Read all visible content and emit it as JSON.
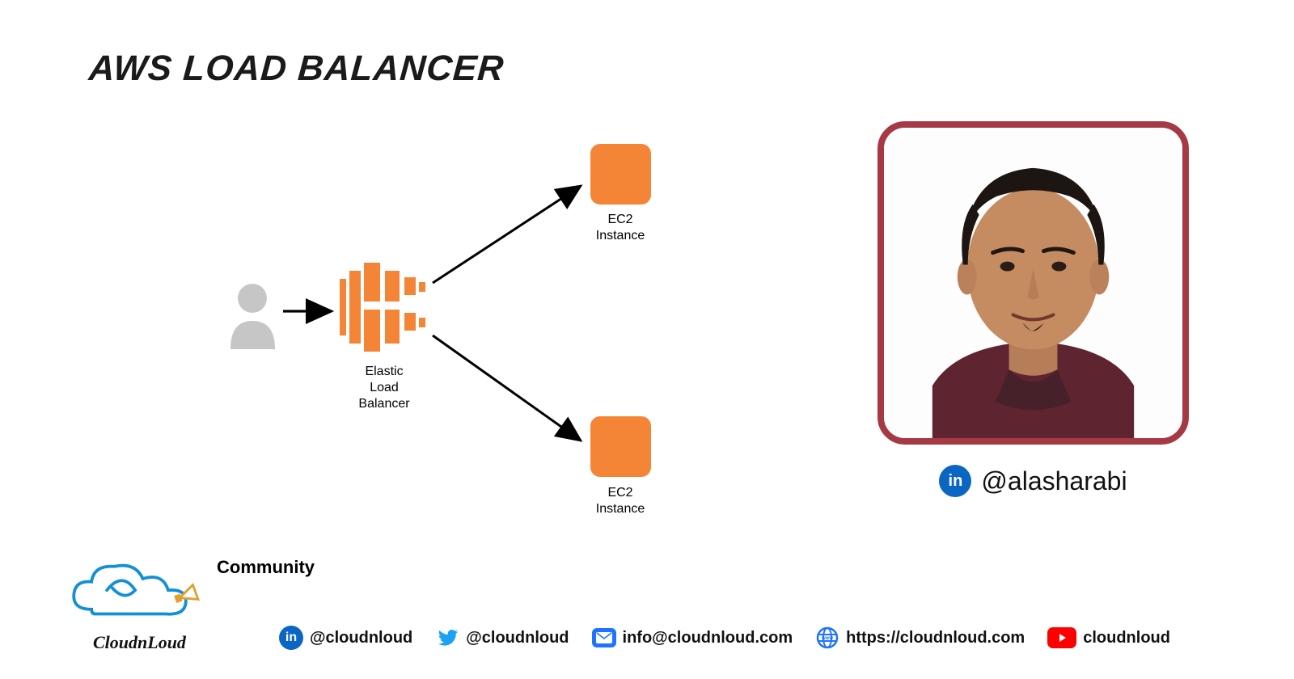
{
  "title": "AWS LOAD BALANCER",
  "diagram": {
    "user_label": "",
    "lb_label_line1": "Elastic",
    "lb_label_line2": "Load",
    "lb_label_line3": "Balancer",
    "ec2_label_line1": "EC2",
    "ec2_label_line2": "Instance"
  },
  "author": {
    "handle": "@alasharabi"
  },
  "community": {
    "label": "Community",
    "brand": "CloudnLoud"
  },
  "socials": {
    "linkedin": "@cloudnloud",
    "twitter": "@cloudnloud",
    "email": "info@cloudnloud.com",
    "website": "https://cloudnloud.com",
    "youtube": "cloudnloud"
  },
  "colors": {
    "aws_orange": "#f58536",
    "author_border": "#a63a44",
    "linkedin": "#0a66c2",
    "twitter": "#1da1f2",
    "mail": "#1e73ff",
    "youtube": "#ff0000",
    "cloud": "#138fd6"
  }
}
